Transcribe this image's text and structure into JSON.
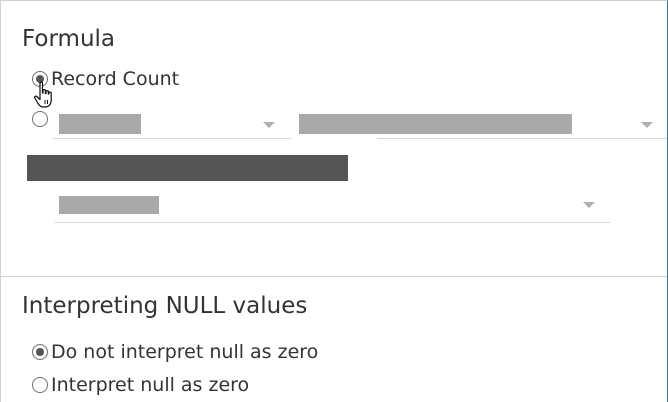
{
  "formula": {
    "title": "Formula",
    "options": [
      {
        "label": "Record Count",
        "selected": true
      },
      {
        "label": "",
        "selected": false
      }
    ]
  },
  "null_handling": {
    "title": "Interpreting NULL values",
    "options": [
      {
        "label": "Do not interpret null as zero",
        "selected": true
      },
      {
        "label": "Interpret null as zero",
        "selected": false
      }
    ]
  },
  "colors": {
    "accent_border": "#2e7fa0",
    "redaction_light": "#a9a9a9",
    "redaction_dark": "#555555"
  },
  "cursor": "hand-pointer-icon"
}
